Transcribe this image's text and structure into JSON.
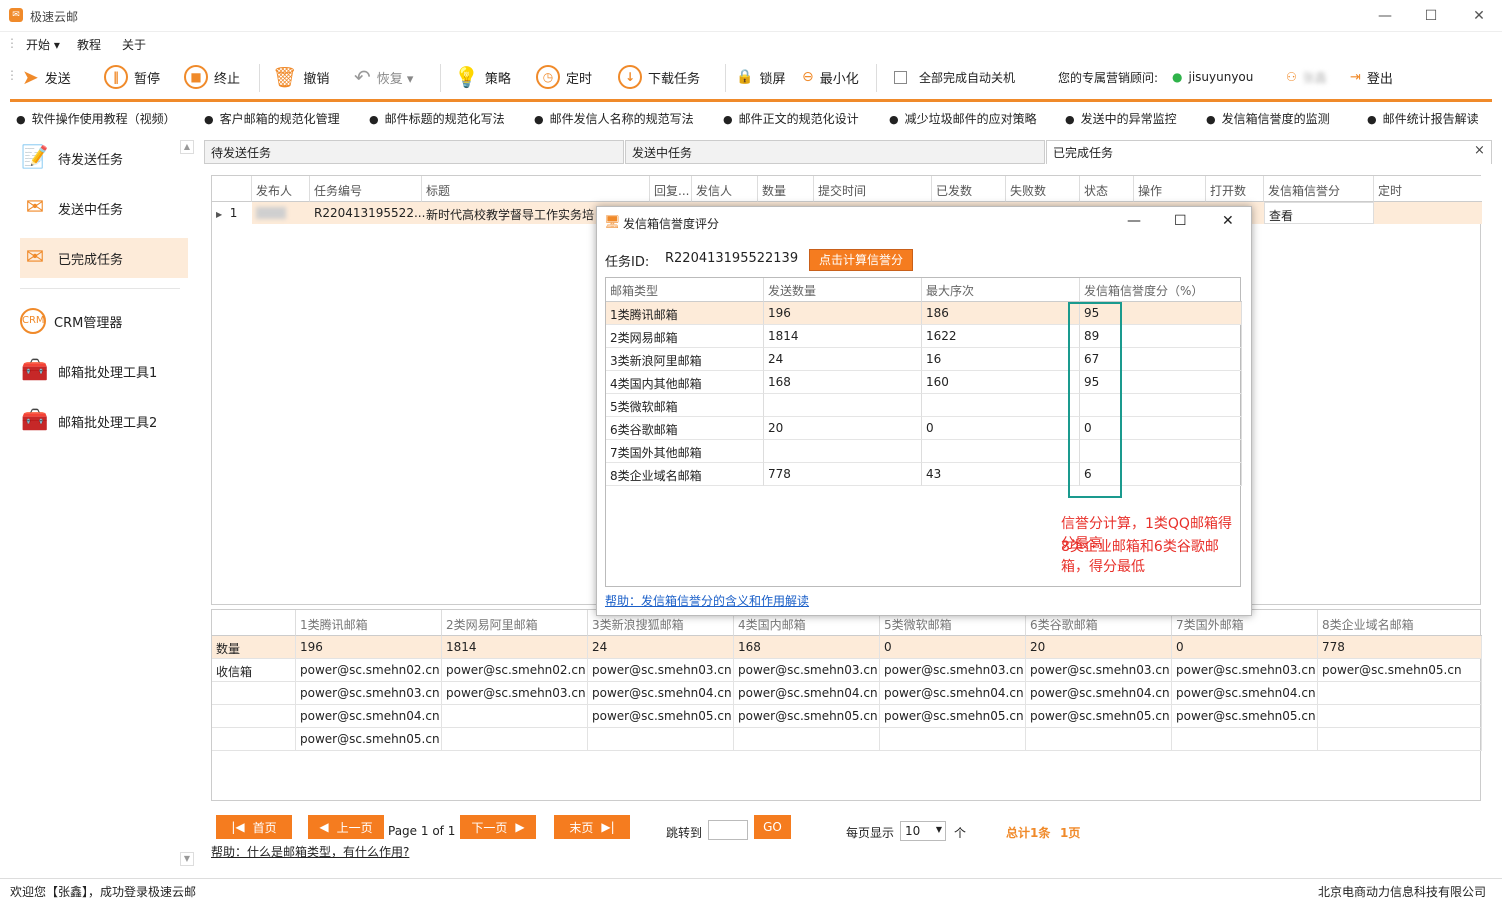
{
  "window": {
    "title": "极速云邮",
    "minimize_glyph": "—",
    "maximize_glyph": "☐",
    "close_glyph": "✕"
  },
  "menu": [
    "开始 ▾",
    "教程",
    "关于"
  ],
  "toolbar": {
    "send": "发送",
    "pause": "暂停",
    "stop": "终止",
    "undo": "撤销",
    "redo": "恢复 ▾",
    "strategy": "策略",
    "schedule": "定时",
    "download": "下载任务",
    "lock": "锁屏",
    "minimize": "最小化",
    "auto_shutdown": "全部完成自动关机",
    "advisor_label": "您的专属营销顾问:",
    "advisor_id": "jisuyunyou",
    "user_label": "张鑫",
    "logout": "登出"
  },
  "links": [
    "软件操作使用教程（视频）",
    "客户邮箱的规范化管理",
    "邮件标题的规范化写法",
    "邮件发信人名称的规范写法",
    "邮件正文的规范化设计",
    "减少垃圾邮件的应对策略",
    "发送中的异常监控",
    "发信箱信誉度的监测",
    "邮件统计报告解读"
  ],
  "sidebar": [
    {
      "label": "待发送任务",
      "icon": "pending-task-icon"
    },
    {
      "label": "发送中任务",
      "icon": "sending-task-icon"
    },
    {
      "label": "已完成任务",
      "icon": "completed-task-icon",
      "active": true
    },
    {
      "label": "CRM管理器",
      "icon": "crm-icon"
    },
    {
      "label": "邮箱批处理工具1",
      "icon": "toolbox-icon"
    },
    {
      "label": "邮箱批处理工具2",
      "icon": "toolbox-icon"
    }
  ],
  "tabs": [
    "待发送任务",
    "发送中任务",
    "已完成任务"
  ],
  "tab_close": "×",
  "main_table": {
    "headers": [
      "发布人",
      "任务编号",
      "标题",
      "回复...",
      "发信人",
      "数量",
      "提交时间",
      "已发数",
      "失败数",
      "状态",
      "操作",
      "打开数",
      "发信箱信誉分",
      "定时"
    ],
    "row": {
      "num": "1",
      "publisher": "",
      "task_id": "R220413195522...",
      "title": "新时代高校教学督导工作实务培",
      "action": "查看"
    }
  },
  "dialog": {
    "title": "发信箱信誉度评分",
    "task_label": "任务ID:",
    "task_id": "R220413195522139",
    "calc_button": "点击计算信誉分",
    "headers": [
      "邮箱类型",
      "发送数量",
      "最大序次",
      "发信箱信誉度分（%）"
    ],
    "rows": [
      [
        "1类腾讯邮箱",
        "196",
        "186",
        "95"
      ],
      [
        "2类网易邮箱",
        "1814",
        "1622",
        "89"
      ],
      [
        "3类新浪阿里邮箱",
        "24",
        "16",
        "67"
      ],
      [
        "4类国内其他邮箱",
        "168",
        "160",
        "95"
      ],
      [
        "5类微软邮箱",
        "",
        "",
        ""
      ],
      [
        "6类谷歌邮箱",
        "20",
        "0",
        "0"
      ],
      [
        "7类国外其他邮箱",
        "",
        "",
        ""
      ],
      [
        "8类企业域名邮箱",
        "778",
        "43",
        "6"
      ]
    ],
    "annotation_line1": "信誉分计算，1类QQ邮箱得分最高",
    "annotation_line2": "8类企业邮箱和6类谷歌邮箱，得分最低",
    "help": "帮助：发信箱信誉分的含义和作用解读"
  },
  "bottom_table": {
    "headers": [
      "",
      "1类腾讯邮箱",
      "2类网易阿里邮箱",
      "3类新浪搜狐邮箱",
      "4类国内邮箱",
      "5类微软邮箱",
      "6类谷歌邮箱",
      "7类国外邮箱",
      "8类企业域名邮箱"
    ],
    "rows": [
      [
        "数量",
        "196",
        "1814",
        "24",
        "168",
        "0",
        "20",
        "0",
        "778"
      ],
      [
        "收信箱",
        "power@sc.smehn02.cn",
        "power@sc.smehn02.cn",
        "power@sc.smehn03.cn",
        "power@sc.smehn03.cn",
        "power@sc.smehn03.cn",
        "power@sc.smehn03.cn",
        "power@sc.smehn03.cn",
        "power@sc.smehn05.cn"
      ],
      [
        "",
        "power@sc.smehn03.cn",
        "power@sc.smehn03.cn",
        "power@sc.smehn04.cn",
        "power@sc.smehn04.cn",
        "power@sc.smehn04.cn",
        "power@sc.smehn04.cn",
        "power@sc.smehn04.cn",
        ""
      ],
      [
        "",
        "power@sc.smehn04.cn",
        "",
        "power@sc.smehn05.cn",
        "power@sc.smehn05.cn",
        "power@sc.smehn05.cn",
        "power@sc.smehn05.cn",
        "power@sc.smehn05.cn",
        ""
      ],
      [
        "",
        "power@sc.smehn05.cn",
        "",
        "",
        "",
        "",
        "",
        "",
        ""
      ]
    ]
  },
  "pager": {
    "first": "首页",
    "prev": "上一页",
    "page_info": "Page 1 of 1",
    "next": "下一页",
    "last": "末页",
    "jump_label": "跳转到",
    "go": "GO",
    "per_page_label": "每页显示",
    "per_page": "10",
    "per_page_unit": "个",
    "total": "总计1条",
    "pages": "1页"
  },
  "help_bottom": "帮助：什么是邮箱类型，有什么作用?",
  "status": {
    "left": "欢迎您【张鑫】，成功登录极速云邮",
    "right": "北京电商动力信息科技有限公司"
  },
  "colors": {
    "accent": "#f08a2a",
    "highlight": "#fdebd9",
    "annotation": "#e8302a",
    "box": "#1a9a8e"
  }
}
